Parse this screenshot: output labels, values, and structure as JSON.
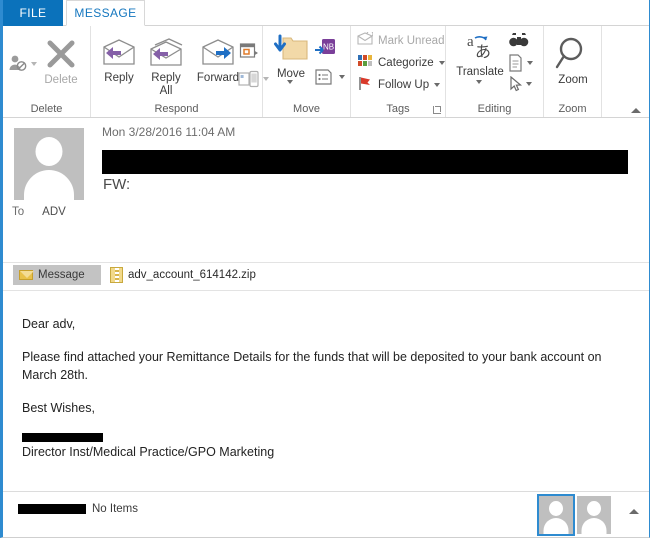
{
  "window": {
    "accent_color": "#2e8bd0"
  },
  "tabs": [
    {
      "id": "file",
      "label": "FILE",
      "active": false,
      "bg": "#0b72bb"
    },
    {
      "id": "message",
      "label": "MESSAGE",
      "active": true,
      "bg": "#ffffff"
    }
  ],
  "ribbon": {
    "groups": [
      {
        "name": "delete",
        "label": "Delete",
        "items": [
          {
            "name": "ignore-button",
            "label": "",
            "icon": "person-block-icon",
            "disabled": true,
            "has_caret": true
          },
          {
            "name": "delete-button",
            "label": "Delete",
            "icon": "x-icon",
            "disabled": true,
            "has_caret": false
          }
        ]
      },
      {
        "name": "respond",
        "label": "Respond",
        "items": [
          {
            "name": "reply-button",
            "label": "Reply",
            "icon": "envelope-left-arrow-icon",
            "disabled": false,
            "has_caret": false
          },
          {
            "name": "reply-all-button",
            "label": "Reply\nAll",
            "icon": "envelope-left-arrow-icon",
            "disabled": false,
            "has_caret": false
          },
          {
            "name": "forward-button",
            "label": "Forward",
            "icon": "envelope-right-arrow-icon",
            "disabled": false,
            "has_caret": false
          },
          {
            "name": "meeting-button",
            "label": "",
            "icon": "calendar-reply-icon",
            "disabled": false,
            "has_caret": false
          },
          {
            "name": "more-respond-button",
            "label": "",
            "icon": "im-message-icon",
            "disabled": true,
            "has_caret": true
          }
        ]
      },
      {
        "name": "move",
        "label": "Move",
        "items": [
          {
            "name": "move-button",
            "label": "Move",
            "icon": "folder-down-arrow-icon",
            "disabled": false,
            "has_caret": true
          },
          {
            "name": "onenote-button",
            "label": "",
            "icon": "onenote-icon",
            "disabled": false,
            "has_caret": false
          },
          {
            "name": "rules-button",
            "label": "",
            "icon": "rules-icon",
            "disabled": false,
            "has_caret": true
          }
        ]
      },
      {
        "name": "tags",
        "label": "Tags",
        "items": [
          {
            "name": "mark-unread-button",
            "label": "Mark Unread",
            "icon": "envelope-unread-icon",
            "disabled": true,
            "has_caret": false
          },
          {
            "name": "categorize-button",
            "label": "Categorize",
            "icon": "color-squares-icon",
            "disabled": false,
            "has_caret": true
          },
          {
            "name": "follow-up-button",
            "label": "Follow Up",
            "icon": "red-flag-icon",
            "disabled": false,
            "has_caret": true
          }
        ],
        "has_dialog_launcher": true
      },
      {
        "name": "editing",
        "label": "Editing",
        "items": [
          {
            "name": "translate-button",
            "label": "Translate",
            "icon": "translate-icon",
            "disabled": false,
            "has_caret": true
          },
          {
            "name": "find-button",
            "label": "",
            "icon": "binoculars-icon",
            "disabled": false,
            "has_caret": false
          },
          {
            "name": "related-button",
            "label": "",
            "icon": "document-icon",
            "disabled": false,
            "has_caret": true
          },
          {
            "name": "select-button",
            "label": "",
            "icon": "cursor-arrow-icon",
            "disabled": false,
            "has_caret": true
          }
        ]
      },
      {
        "name": "zoom",
        "label": "Zoom",
        "items": [
          {
            "name": "zoom-button",
            "label": "Zoom",
            "icon": "magnifier-icon",
            "disabled": false,
            "has_caret": false
          }
        ]
      }
    ],
    "collapse_icon": "chevron-up-icon"
  },
  "header": {
    "avatar_icon": "contact-photo-placeholder",
    "datetime": "Mon 3/28/2016 11:04 AM",
    "sender_redacted": true,
    "subject": "FW:",
    "to_label": "To",
    "to_value": "ADV"
  },
  "attachments": {
    "message_tab_label": "Message",
    "message_tab_icon": "envelope-icon",
    "items": [
      {
        "name": "attachment-zip",
        "label": "adv_account_614142.zip",
        "icon": "zip-file-icon"
      }
    ]
  },
  "body": {
    "greeting": "Dear adv,",
    "paragraph": "Please find attached your Remittance Details for the funds that will be deposited to your bank account on March 28th.",
    "closing": "Best Wishes,",
    "signer_redacted": true,
    "title": "Director Inst/Medical Practice/GPO Marketing"
  },
  "status": {
    "name_redacted": true,
    "items_text": "No Items",
    "thumbnails": [
      {
        "name": "people-pane-thumb-1",
        "selected": true,
        "icon": "contact-photo-placeholder"
      },
      {
        "name": "people-pane-thumb-2",
        "selected": false,
        "icon": "contact-photo-placeholder"
      }
    ],
    "expand_icon": "chevron-up-icon"
  }
}
